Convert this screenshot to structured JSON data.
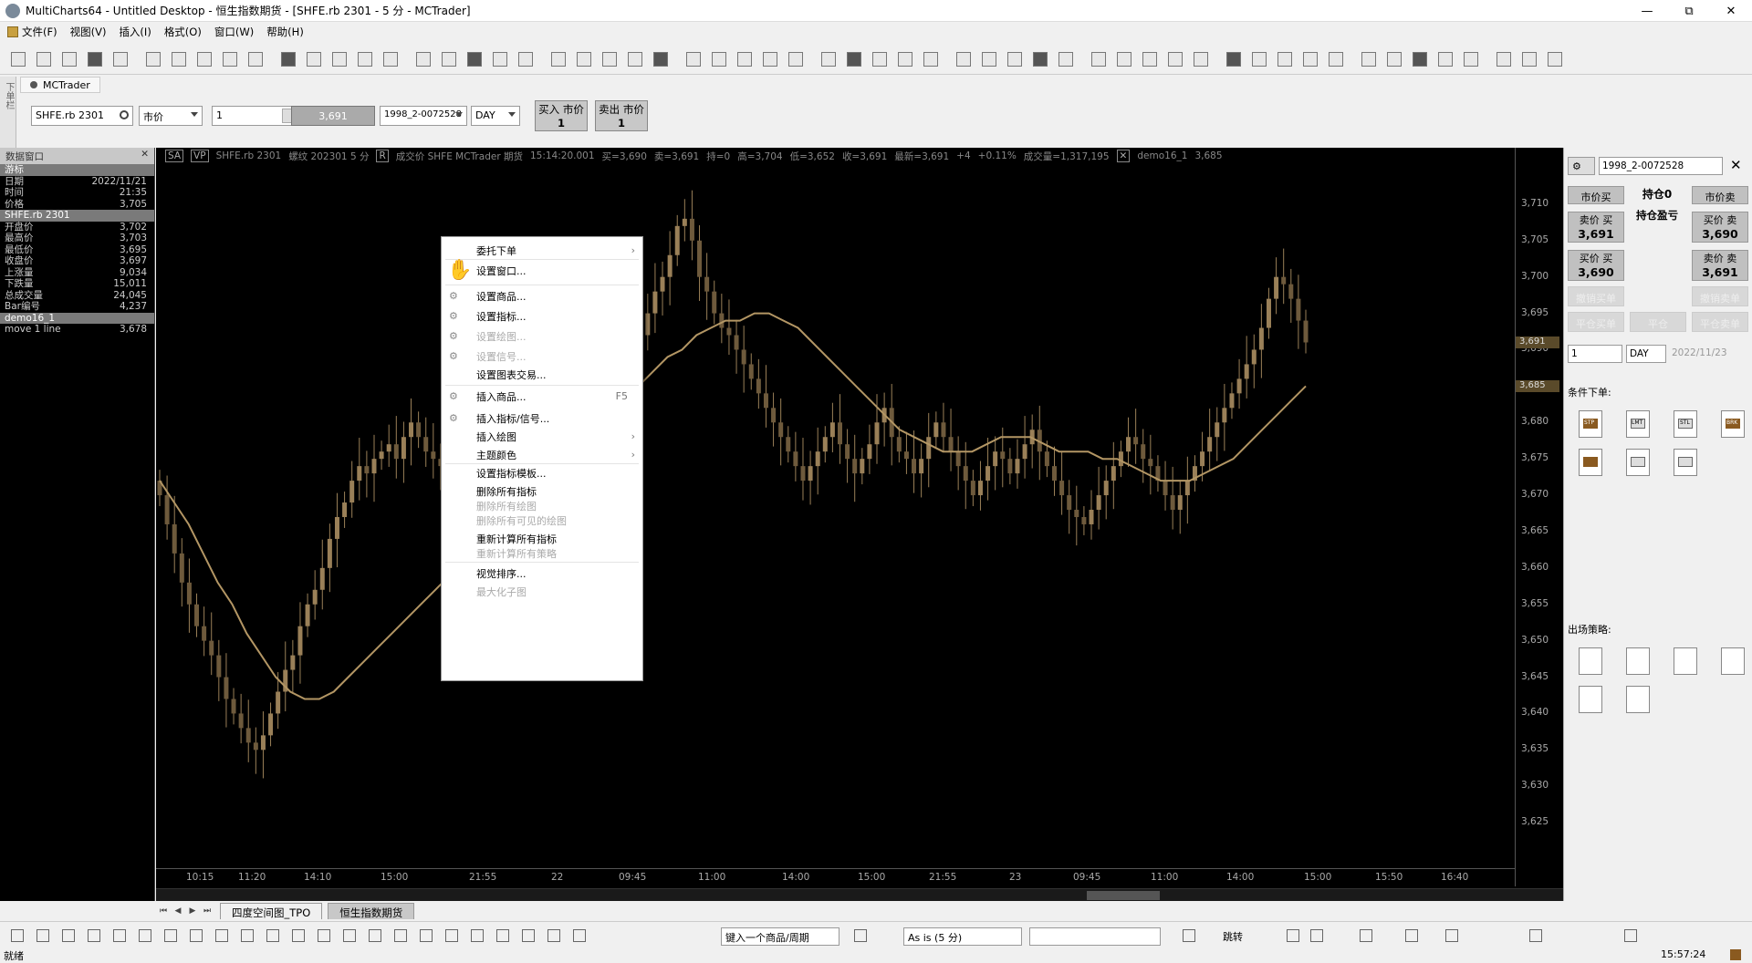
{
  "window": {
    "title": "MultiCharts64 - Untitled Desktop - 恒生指数期货 - [SHFE.rb 2301 - 5 分 - MCTrader]"
  },
  "menu": [
    "文件(F)",
    "视图(V)",
    "插入(I)",
    "格式(O)",
    "窗口(W)",
    "帮助(H)"
  ],
  "left_tab": "下单栏",
  "mctrader_tab": "MCTrader",
  "order_bar": {
    "symbol": "SHFE.rb 2301",
    "order_type": "市价",
    "quantity": "1",
    "price": "3,691",
    "account": "1998_2-0072528",
    "tif": "DAY",
    "buy_label": "买入 市价",
    "buy_qty": "1",
    "sell_label": "卖出 市价",
    "sell_qty": "1"
  },
  "data_window": {
    "title": "数据窗口",
    "rows": [
      {
        "k": "游标",
        "v": "",
        "hl": true
      },
      {
        "k": "日期",
        "v": "2022/11/21"
      },
      {
        "k": "时间",
        "v": "21:35"
      },
      {
        "k": "价格",
        "v": "3,705"
      },
      {
        "k": "SHFE.rb 2301",
        "v": "",
        "hl": true
      },
      {
        "k": "开盘价",
        "v": "3,702"
      },
      {
        "k": "最高价",
        "v": "3,703"
      },
      {
        "k": "最低价",
        "v": "3,695"
      },
      {
        "k": "收盘价",
        "v": "3,697"
      },
      {
        "k": "上涨量",
        "v": "9,034"
      },
      {
        "k": "下跌量",
        "v": "15,011"
      },
      {
        "k": "总成交量",
        "v": "24,045"
      },
      {
        "k": "Bar编号",
        "v": "4,237"
      },
      {
        "k": "demo16_1",
        "v": "",
        "hl": true
      },
      {
        "k": "move 1 line",
        "v": "3,678"
      }
    ]
  },
  "chart_header": {
    "sa": "SA",
    "vp": "VP",
    "symbol": "SHFE.rb 2301",
    "name": "螺纹 202301 5 分",
    "r": "R",
    "desc": "成交价 SHFE MCTrader 期货",
    "time": "15:14:20.001",
    "bid": "买=3,690",
    "ask": "卖=3,691",
    "pos": "持=0",
    "high": "高=3,704",
    "low": "低=3,652",
    "close": "收=3,691",
    "last": "最新=3,691",
    "chg": "+4",
    "pct": "+0.11%",
    "volume": "成交量=1,317,195",
    "study": "demo16_1",
    "study_val": "3,685"
  },
  "chart_data": {
    "type": "candlestick",
    "ylim": [
      3620,
      3715
    ],
    "y_ticks": [
      "3,710",
      "3,705",
      "3,700",
      "3,695",
      "3,690",
      "3,685",
      "3,680",
      "3,675",
      "3,670",
      "3,665",
      "3,660",
      "3,655",
      "3,650",
      "3,645",
      "3,640",
      "3,635",
      "3,630",
      "3,625"
    ],
    "x_ticks": [
      "10:15",
      "11:20",
      "14:10",
      "15:00",
      "21:55",
      "22",
      "09:45",
      "11:00",
      "14:00",
      "15:00",
      "21:55",
      "23",
      "09:45",
      "11:00",
      "14:00",
      "15:00",
      "15:50",
      "16:40"
    ],
    "last_price": "3,691",
    "ma_value": "3,685",
    "series": [
      {
        "name": "SHFE.rb 2301",
        "close": [
          3670,
          3666,
          3662,
          3658,
          3655,
          3652,
          3650,
          3648,
          3645,
          3642,
          3640,
          3638,
          3636,
          3635,
          3637,
          3640,
          3643,
          3646,
          3648,
          3652,
          3655,
          3657,
          3660,
          3664,
          3667,
          3669,
          3672,
          3674,
          3673,
          3675,
          3676,
          3677,
          3675,
          3678,
          3680,
          3678,
          3676,
          3675,
          3674,
          3678,
          3682,
          3685,
          3688,
          3690,
          3693,
          3695,
          3697,
          3699,
          3700,
          3702,
          3698,
          3695,
          3692,
          3688,
          3686,
          3684,
          3682,
          3680,
          3678,
          3680,
          3682,
          3684,
          3685,
          3688,
          3690,
          3692,
          3695,
          3698,
          3700,
          3703,
          3707,
          3708,
          3705,
          3700,
          3698,
          3695,
          3693,
          3692,
          3690,
          3688,
          3686,
          3684,
          3682,
          3680,
          3678,
          3676,
          3674,
          3672,
          3674,
          3676,
          3678,
          3680,
          3677,
          3675,
          3673,
          3675,
          3677,
          3680,
          3682,
          3678,
          3676,
          3675,
          3673,
          3675,
          3678,
          3680,
          3678,
          3676,
          3674,
          3672,
          3670,
          3672,
          3674,
          3676,
          3675,
          3673,
          3675,
          3677,
          3679,
          3676,
          3674,
          3672,
          3670,
          3668,
          3667,
          3666,
          3668,
          3670,
          3672,
          3674,
          3676,
          3678,
          3677,
          3675,
          3674,
          3672,
          3670,
          3668,
          3670,
          3672,
          3674,
          3676,
          3678,
          3680,
          3682,
          3684,
          3686,
          3688,
          3690,
          3693,
          3697,
          3700,
          3699,
          3697,
          3694,
          3691
        ]
      },
      {
        "name": "demo16_1",
        "values": [
          3672,
          3669,
          3666,
          3662,
          3658,
          3655,
          3651,
          3648,
          3645,
          3643,
          3642,
          3642,
          3643,
          3645,
          3647,
          3649,
          3651,
          3653,
          3655,
          3657,
          3659,
          3661,
          3663,
          3665,
          3667,
          3669,
          3671,
          3673,
          3675,
          3677,
          3679,
          3681,
          3683,
          3685,
          3687,
          3689,
          3690,
          3692,
          3693,
          3694,
          3694,
          3695,
          3695,
          3694,
          3693,
          3691,
          3689,
          3687,
          3685,
          3683,
          3681,
          3679,
          3678,
          3677,
          3676,
          3676,
          3676,
          3677,
          3678,
          3678,
          3678,
          3677,
          3676,
          3676,
          3676,
          3675,
          3675,
          3674,
          3673,
          3672,
          3672,
          3672,
          3673,
          3674,
          3675,
          3677,
          3679,
          3681,
          3683,
          3685
        ]
      }
    ]
  },
  "context_menu": [
    {
      "label": "委托下单",
      "sub": true,
      "dis": false
    },
    {
      "label": "设置窗口...",
      "sub": false,
      "dis": false
    },
    {
      "label": "设置商品...",
      "sub": false,
      "dis": false
    },
    {
      "label": "设置指标...",
      "sub": false,
      "dis": false
    },
    {
      "label": "设置绘图...",
      "sub": false,
      "dis": true
    },
    {
      "label": "设置信号...",
      "sub": false,
      "dis": true
    },
    {
      "label": "设置图表交易...",
      "sub": false,
      "dis": false
    },
    {
      "label": "插入商品...",
      "sub": false,
      "dis": false,
      "key": "F5"
    },
    {
      "label": "插入指标/信号...",
      "sub": false,
      "dis": false
    },
    {
      "label": "插入绘图",
      "sub": true,
      "dis": false
    },
    {
      "label": "主题颜色",
      "sub": true,
      "dis": false
    },
    {
      "label": "设置指标模板...",
      "sub": false,
      "dis": false
    },
    {
      "label": "删除所有指标",
      "sub": false,
      "dis": false
    },
    {
      "label": "删除所有绘图",
      "sub": false,
      "dis": true
    },
    {
      "label": "删除所有可见的绘图",
      "sub": false,
      "dis": true
    },
    {
      "label": "重新计算所有指标",
      "sub": false,
      "dis": false
    },
    {
      "label": "重新计算所有策略",
      "sub": false,
      "dis": true
    },
    {
      "label": "视觉排序...",
      "sub": false,
      "dis": false
    },
    {
      "label": "最大化子图",
      "sub": false,
      "dis": true
    }
  ],
  "trade_panel": {
    "account": "1998_2-0072528",
    "mkt_buy": "市价买",
    "position": "持仓0",
    "mkt_sell": "市价卖",
    "pnl": "持仓盈亏",
    "sell_price_buy_label": "卖价 买",
    "sell_price_buy": "3,691",
    "buy_price_sell_label": "买价 卖",
    "buy_price_sell": "3,690",
    "bid_buy_label": "买价 买",
    "bid_buy": "3,690",
    "ask_sell_label": "卖价 卖",
    "ask_sell": "3,691",
    "cancel_buy": "撤销买单",
    "cancel_sell": "撤销卖单",
    "flat_buy": "平仓买单",
    "flat": "平仓",
    "flat_sell": "平仓卖单",
    "qty": "1",
    "tif": "DAY",
    "date": "2022/11/23",
    "cond_label": "条件下单:",
    "cond_icons": [
      "STP",
      "LMT",
      "STL",
      "BRK"
    ],
    "exit_label": "出场策略:"
  },
  "sheets": [
    "四度空间图_TPO",
    "恒生指数期货"
  ],
  "drawbar": {
    "symbol_placeholder": "键入一个商品/周期",
    "resolution": "As is (5 分)",
    "jump": "跳转"
  },
  "status": {
    "text": "就绪",
    "time": "15:57:24"
  },
  "colors": {
    "candle": "#9a8058",
    "ma": "#b39664",
    "chart_bg": "#000000"
  }
}
